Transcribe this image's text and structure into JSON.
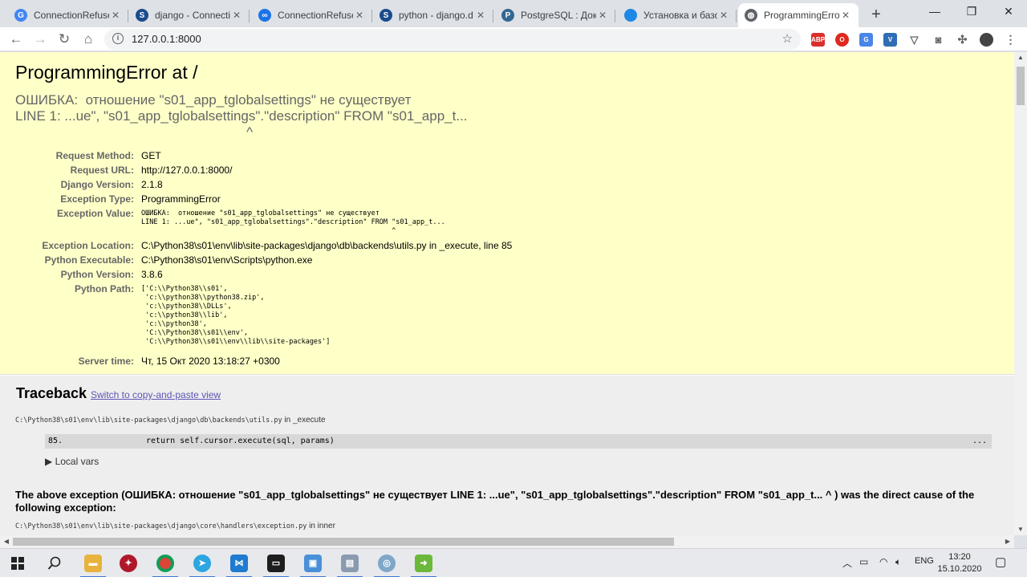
{
  "browser": {
    "tabs": [
      {
        "title": "ConnectionRefuse",
        "icon": "google-icon",
        "color": "#4285f4",
        "glyph": "G",
        "active": false
      },
      {
        "title": "django - Connectio",
        "icon": "stackoverflow-icon",
        "color": "#1a4c8c",
        "glyph": "S",
        "active": false
      },
      {
        "title": "ConnectionRefuse",
        "icon": "link-icon",
        "color": "#1a73e8",
        "glyph": "∞",
        "active": false
      },
      {
        "title": "python - django.d",
        "icon": "stackoverflow-icon",
        "color": "#1a4c8c",
        "glyph": "S",
        "active": false
      },
      {
        "title": "PostgreSQL : Доку",
        "icon": "postgresql-icon",
        "color": "#336791",
        "glyph": "P",
        "active": false
      },
      {
        "title": "Установка и базо",
        "icon": "page-icon",
        "color": "#1e88e5",
        "glyph": "",
        "active": false
      },
      {
        "title": "ProgrammingError",
        "icon": "globe-icon",
        "color": "#5f6368",
        "glyph": "◍",
        "active": true
      }
    ],
    "url": "127.0.0.1:8000"
  },
  "error": {
    "title": "ProgrammingError at /",
    "value_lines": "ОШИБКА:  отношение \"s01_app_tglobalsettings\" не существует\nLINE 1: ...ue\", \"s01_app_tglobalsettings\".\"description\" FROM \"s01_app_t...\n                                                             ^"
  },
  "meta": [
    {
      "key": "Request Method:",
      "value": "GET"
    },
    {
      "key": "Request URL:",
      "value": "http://127.0.0.1:8000/"
    },
    {
      "key": "Django Version:",
      "value": "2.1.8"
    },
    {
      "key": "Exception Type:",
      "value": "ProgrammingError"
    },
    {
      "key": "Exception Value:",
      "value": "ОШИБКА:  отношение \"s01_app_tglobalsettings\" не существует\nLINE 1: ...ue\", \"s01_app_tglobalsettings\".\"description\" FROM \"s01_app_t...\n                                                             ^"
    },
    {
      "key": "Exception Location:",
      "value": "C:\\Python38\\s01\\env\\lib\\site-packages\\django\\db\\backends\\utils.py in _execute, line 85"
    },
    {
      "key": "Python Executable:",
      "value": "C:\\Python38\\s01\\env\\Scripts\\python.exe"
    },
    {
      "key": "Python Version:",
      "value": "3.8.6"
    },
    {
      "key": "Python Path:",
      "value": "['C:\\\\Python38\\\\s01',\n 'c:\\\\python38\\\\python38.zip',\n 'c:\\\\python38\\\\DLLs',\n 'c:\\\\python38\\\\lib',\n 'c:\\\\python38',\n 'C:\\\\Python38\\\\s01\\\\env',\n 'C:\\\\Python38\\\\s01\\\\env\\\\lib\\\\site-packages']"
    },
    {
      "key": "Server time:",
      "value": "Чт, 15 Окт 2020 13:18:27 +0300"
    }
  ],
  "traceback": {
    "heading": "Traceback",
    "switch_link": "Switch to copy-and-paste view",
    "frame1_file": "C:\\Python38\\s01\\env\\lib\\site-packages\\django\\db\\backends\\utils.py",
    "frame1_in": " in _execute",
    "frame1_lineno": "85.",
    "frame1_source": "return self.cursor.execute(sql, params)",
    "frame1_dots": "...",
    "local_vars": "▶ Local vars",
    "cause_text": "The above exception (ОШИБКА: отношение \"s01_app_tglobalsettings\" не существует LINE 1: ...ue\", \"s01_app_tglobalsettings\".\"description\" FROM \"s01_app_t... ^ ) was the direct cause of the following exception:",
    "frame2_file": "C:\\Python38\\s01\\env\\lib\\site-packages\\django\\core\\handlers\\exception.py",
    "frame2_in": " in inner"
  },
  "taskbar": {
    "language": "ENG",
    "time": "13:20",
    "date": "15.10.2020"
  }
}
